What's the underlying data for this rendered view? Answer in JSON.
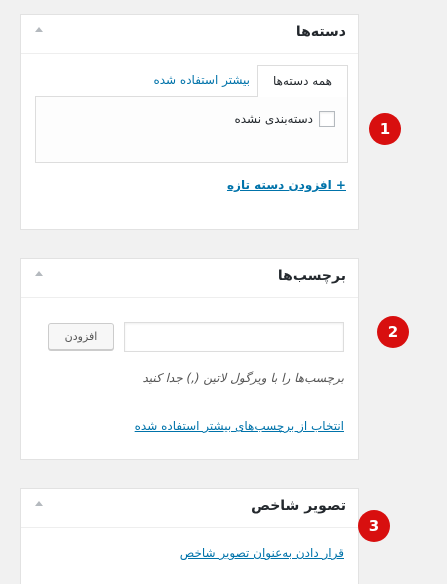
{
  "categories_box": {
    "title": "دسته‌ها",
    "tabs": [
      {
        "label": "همه دسته‌ها",
        "active": true
      },
      {
        "label": "بیشتر استفاده شده",
        "active": false
      }
    ],
    "items": [
      {
        "label": "دسته‌بندی نشده",
        "checked": false
      }
    ],
    "add_new_link": "+ افزودن دسته تازه"
  },
  "tags_box": {
    "title": "برچسب‌ها",
    "input_value": "",
    "add_button": "افزودن",
    "hint": "برچسب‌ها را با ویرگول لاتین (,) جدا کنید",
    "popular_link": "انتخاب از برچسب‌های بیشتر استفاده شده"
  },
  "featured_image_box": {
    "title": "تصویر شاخص",
    "set_link": "قرار دادن به‌عنوان تصویر شاخص"
  },
  "annotations": [
    "1",
    "2",
    "3"
  ],
  "colors": {
    "link": "#0073aa",
    "marker": "#d80f0f",
    "background": "#f1f1f1"
  }
}
